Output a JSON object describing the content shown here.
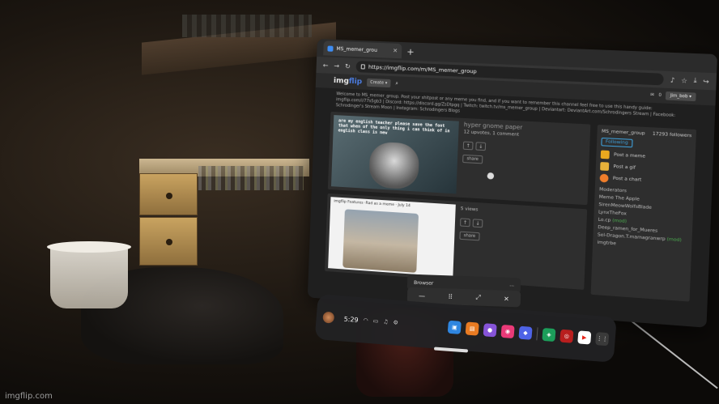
{
  "browser": {
    "tab_title": "MS_memer_grou",
    "new_tab": "+",
    "url": "https://imgflip.com/m/MS_memer_group",
    "nav_icons": [
      "back-icon",
      "forward-icon",
      "refresh-icon"
    ],
    "toolbar_icons": [
      "mic-icon",
      "star-icon",
      "download-icon",
      "share-icon"
    ]
  },
  "site": {
    "logo_a": "img",
    "logo_b": "flip",
    "create_label": "Create ▾",
    "user_label": "Jim_bob ▾",
    "notif_count": "0",
    "description": "Welcome to MS_memer_group. Post your shitpost or any meme you find, and if you want to remember this channel feel free to use this handy guide: imgflip.com/i/77s5gb3 | Discord: https://discord.gg/ZsDtpgq | Twitch: twitch.tv/ms_memer_group | Deviantart: DeviantArt.com/Schrodingers Stream | Facebook: Schrodinger's Stream Moon | Instagram: Schrodingers Blogs"
  },
  "posts": [
    {
      "caption": "are my english teacher please save the font that when of the only thing i can think of in english class is new",
      "title": "hyper gnome paper",
      "sub": "12 upvotes, 1 comment",
      "share": "share",
      "up": "↑",
      "down": "↓"
    },
    {
      "header": "imgflip Features ·Rad as a meme · July 14",
      "title": "",
      "sub": "5 views",
      "share": "share",
      "up": "↑",
      "down": "↓"
    }
  ],
  "sidebar": {
    "name": "MS_memer_group",
    "followers": "17293 followers",
    "follow_label": "Following",
    "actions": [
      {
        "label": "Post a meme",
        "color": "#e9a91f"
      },
      {
        "label": "Post a gif",
        "color": "#e7b13a"
      },
      {
        "label": "Post a chart",
        "color": "#f07e2b"
      }
    ],
    "mods_title": "Moderators",
    "mods": [
      {
        "name": "Meme The Apple",
        "status": ""
      },
      {
        "name": "SirenMeowWolfsBlade",
        "status": ""
      },
      {
        "name": "LynxTheFox",
        "status": ""
      },
      {
        "name": "Lo.cp",
        "status": "(mod)"
      },
      {
        "name": "Deep_ramen_for_Mueres",
        "status": ""
      },
      {
        "name": "Sel-Dragon.T.mamagranwrp",
        "status": "(mod)"
      },
      {
        "name": "imgtrbe",
        "status": ""
      }
    ]
  },
  "popup": {
    "title": "Browser",
    "dots": "···",
    "close": "✕",
    "controls": [
      "—",
      "⠿",
      "⤢"
    ]
  },
  "taskbar": {
    "time": "5:29",
    "apps": [
      {
        "icon": "store-icon",
        "glyph": "▣",
        "color": "#2f86e0"
      },
      {
        "icon": "library-icon",
        "glyph": "▤",
        "color": "#e97b22"
      },
      {
        "icon": "people-icon",
        "glyph": "●",
        "color": "#8654d8"
      },
      {
        "icon": "camera-icon",
        "glyph": "◉",
        "color": "#ea3a78"
      },
      {
        "icon": "messenger-icon",
        "glyph": "◆",
        "color": "#4e63e6"
      },
      {
        "icon": "browser-icon",
        "glyph": "◈",
        "color": "#1c9e5a"
      },
      {
        "icon": "game-icon",
        "glyph": "◎",
        "color": "#b81e1e"
      },
      {
        "icon": "youtube-icon",
        "glyph": "▶",
        "color": "#ffffff"
      },
      {
        "icon": "apps-grid-icon",
        "glyph": "⋮⋮",
        "color": "#3a3a3a"
      }
    ]
  },
  "watermark": "imgflip.com"
}
